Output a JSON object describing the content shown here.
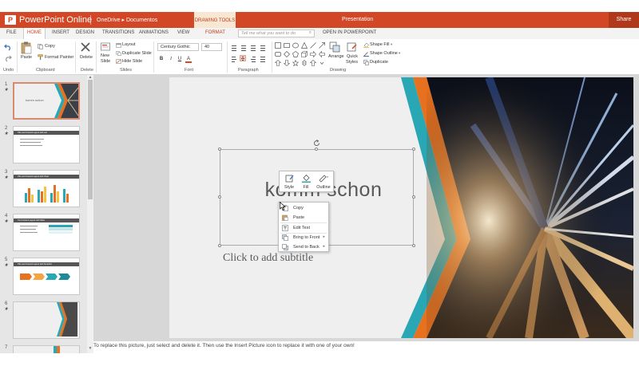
{
  "titlebar": {
    "app_name": "PowerPoint Online",
    "breadcrumb": "OneDrive ▸ Documentos",
    "contextual_tab": "DRAWING TOOLS",
    "doc_title": "Presentation",
    "share": "Share"
  },
  "tabs": {
    "file": "FILE",
    "home": "HOME",
    "insert": "INSERT",
    "design": "DESIGN",
    "transitions": "TRANSITIONS",
    "animations": "ANIMATIONS",
    "view": "VIEW",
    "format": "FORMAT",
    "tell_me": "Tell me what you want to do",
    "open_in": "OPEN IN POWERPOINT"
  },
  "ribbon": {
    "undo": "Undo",
    "paste": "Paste",
    "copy": "Copy",
    "format_painter": "Format Painter",
    "clipboard": "Clipboard",
    "delete": "Delete",
    "delete_group": "Delete",
    "new_slide_1": "New",
    "new_slide_2": "Slide",
    "layout": "Layout",
    "duplicate_slide": "Duplicate Slide",
    "hide_slide": "Hide Slide",
    "slides": "Slides",
    "font_name": "Century Gothic",
    "font_size": "40",
    "bold": "B",
    "italic": "I",
    "underline": "U",
    "font_color": "A",
    "font": "Font",
    "paragraph": "Paragraph",
    "arrange": "Arrange",
    "quick_styles_1": "Quick",
    "quick_styles_2": "Styles",
    "shape_fill": "Shape Fill",
    "shape_outline": "Shape Outline",
    "duplicate": "Duplicate",
    "drawing": "Drawing"
  },
  "thumbnails": [
    {
      "num": "1",
      "title": "komm schon"
    },
    {
      "num": "2",
      "title": "Title and Content Layout with List"
    },
    {
      "num": "3",
      "title": "Title and Content Layout with Chart"
    },
    {
      "num": "4",
      "title": "Two Content Layout with Table"
    },
    {
      "num": "5",
      "title": "Title and Content Layout with SmartArt"
    },
    {
      "num": "6",
      "title": ""
    },
    {
      "num": "7",
      "title": ""
    }
  ],
  "slide": {
    "title": "komm schon",
    "subtitle": "Click to add subtitle"
  },
  "mini_toolbar": {
    "style": "Style",
    "fill": "Fill",
    "outline": "Outline"
  },
  "context_menu": {
    "copy": "Copy",
    "paste": "Paste",
    "edit_text": "Edit Text",
    "bring_to_front": "Bring to Front",
    "send_to_back": "Send to Back"
  },
  "status": {
    "notes": "To replace this picture, just select and delete it. Then use the Insert Picture icon to replace it with one of your own!"
  },
  "colors": {
    "brand": "#d24726",
    "teal": "#2aa7b5",
    "orange": "#e8711f"
  }
}
